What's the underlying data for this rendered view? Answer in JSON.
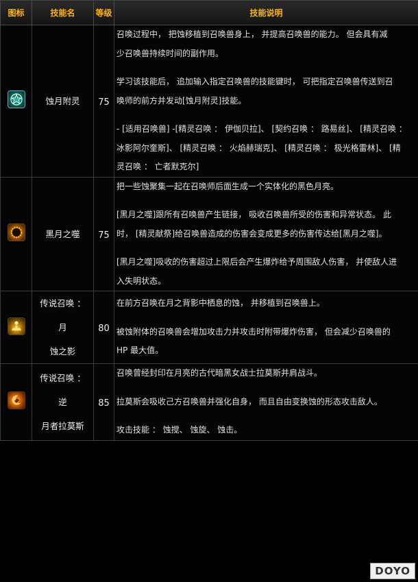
{
  "headers": {
    "icon": "图标",
    "name": "技能名",
    "level": "等级",
    "desc": "技能说明"
  },
  "rows": [
    {
      "icon": "eclipse-moon-icon",
      "name_lines": [
        "蚀月附灵"
      ],
      "level": "75",
      "paragraphs": [
        [
          "召唤过程中， 把蚀移植到召唤兽身上， 并提高召唤兽的能力。 但会具有减",
          "少召唤兽持续时间的副作用。"
        ],
        [
          "学习该技能后， 追加输入指定召唤兽的技能键时， 可把指定召唤兽传送到召",
          "唤师的前方并发动[蚀月附灵]技能。"
        ],
        [
          "- [适用召唤兽] -[精灵召唤 ： 伊伽贝拉]、 [契约召唤 ： 路易丝]、 [精灵召唤 ：",
          "冰影阿尔奎斯]、 [精灵召唤 ： 火焰赫瑞克]、 [精灵召唤 ： 极光格雷林]、 [精",
          "灵召唤 ： 亡者默克尔]"
        ]
      ]
    },
    {
      "icon": "black-moon-icon",
      "name_lines": [
        "黑月之噬"
      ],
      "level": "75",
      "paragraphs": [
        [
          "把一些蚀聚集一起在召唤师后面生成一个实体化的黑色月亮。"
        ],
        [
          "[黑月之噬]跟所有召唤兽产生链接， 吸收召唤兽所受的伤害和异常状态。 此",
          "时， [精灵献祭]给召唤兽造成的伤害会变成更多的伤害传达给[黑月之噬]。"
        ],
        [
          "[黑月之噬]吸收的伤害超过上限后会产生爆炸给予周围敌人伤害， 并使敌人进",
          "入失明状态。"
        ]
      ]
    },
    {
      "icon": "moon-shadow-icon",
      "name_lines": [
        "传说召唤 ： 月",
        "蚀之影"
      ],
      "level": "80",
      "paragraphs": [
        [
          "在前方召唤在月之背影中栖息的蚀， 并移植到召唤兽上。"
        ],
        [
          "被蚀附体的召唤兽会增加攻击力并攻击时附带爆炸伤害， 但会减少召唤兽的",
          "HP 最大值。"
        ]
      ]
    },
    {
      "icon": "lazarus-icon",
      "name_lines": [
        "传说召唤 ： 逆",
        "月者拉莫斯"
      ],
      "level": "85",
      "paragraphs": [
        [
          "召唤曾经封印在月亮的古代暗黑女战士拉莫斯并肩战斗。"
        ],
        [
          " 拉莫斯会吸收己方召唤兽并强化自身， 而且自由变换蚀的形态攻击敌人。"
        ],
        [
          "攻击技能 ： 蚀搅、 蚀旋、 蚀击。"
        ]
      ]
    }
  ],
  "watermark": "DOYO"
}
